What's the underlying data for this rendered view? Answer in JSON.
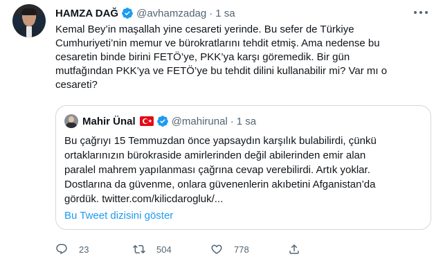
{
  "author": {
    "name": "HAMZA DAĞ",
    "handle": "@avhamzadag",
    "separator": "·",
    "time": "1 sa"
  },
  "tweet_lines": [
    "Kemal Bey’in maşallah yine cesareti yerinde. Bu sefer de Türkiye",
    "Cumhuriyeti’nin memur ve bürokratlarını tehdit etmiş. Ama nedense bu",
    "cesaretin binde birini FETÖ’ye, PKK’ya karşı göremedik. Bir gün",
    "mutfağından PKK’ya ve FETÖ’ye bu tehdit dilini kullanabilir mi? Var mı o",
    "cesareti?"
  ],
  "quoted": {
    "name": "Mahir Ünal",
    "handle": "@mahirunal",
    "separator": "·",
    "time": "1 sa",
    "lines": [
      "Bu çağrıyı 15 Temmuzdan önce yapsaydın karşılık bulabilirdi, çünkü",
      "ortaklarınızın bürokraside amirlerinden değil abilerinden emir alan",
      "paralel mahrem yapılanması çağrına cevap verebilirdi. Artık yoklar.",
      "Dostlarına da güvenme, onlara güvenenlerin akıbetini Afganistan’da",
      "gördük. twitter.com/kilicdarogluk/..."
    ],
    "thread_link": "Bu Tweet dizisini göster"
  },
  "actions": {
    "reply_count": "23",
    "retweet_count": "504",
    "like_count": "778"
  },
  "colors": {
    "accent": "#1d9bf0",
    "text": "#0f1419",
    "secondary": "#536471",
    "border": "#cfd9de"
  }
}
